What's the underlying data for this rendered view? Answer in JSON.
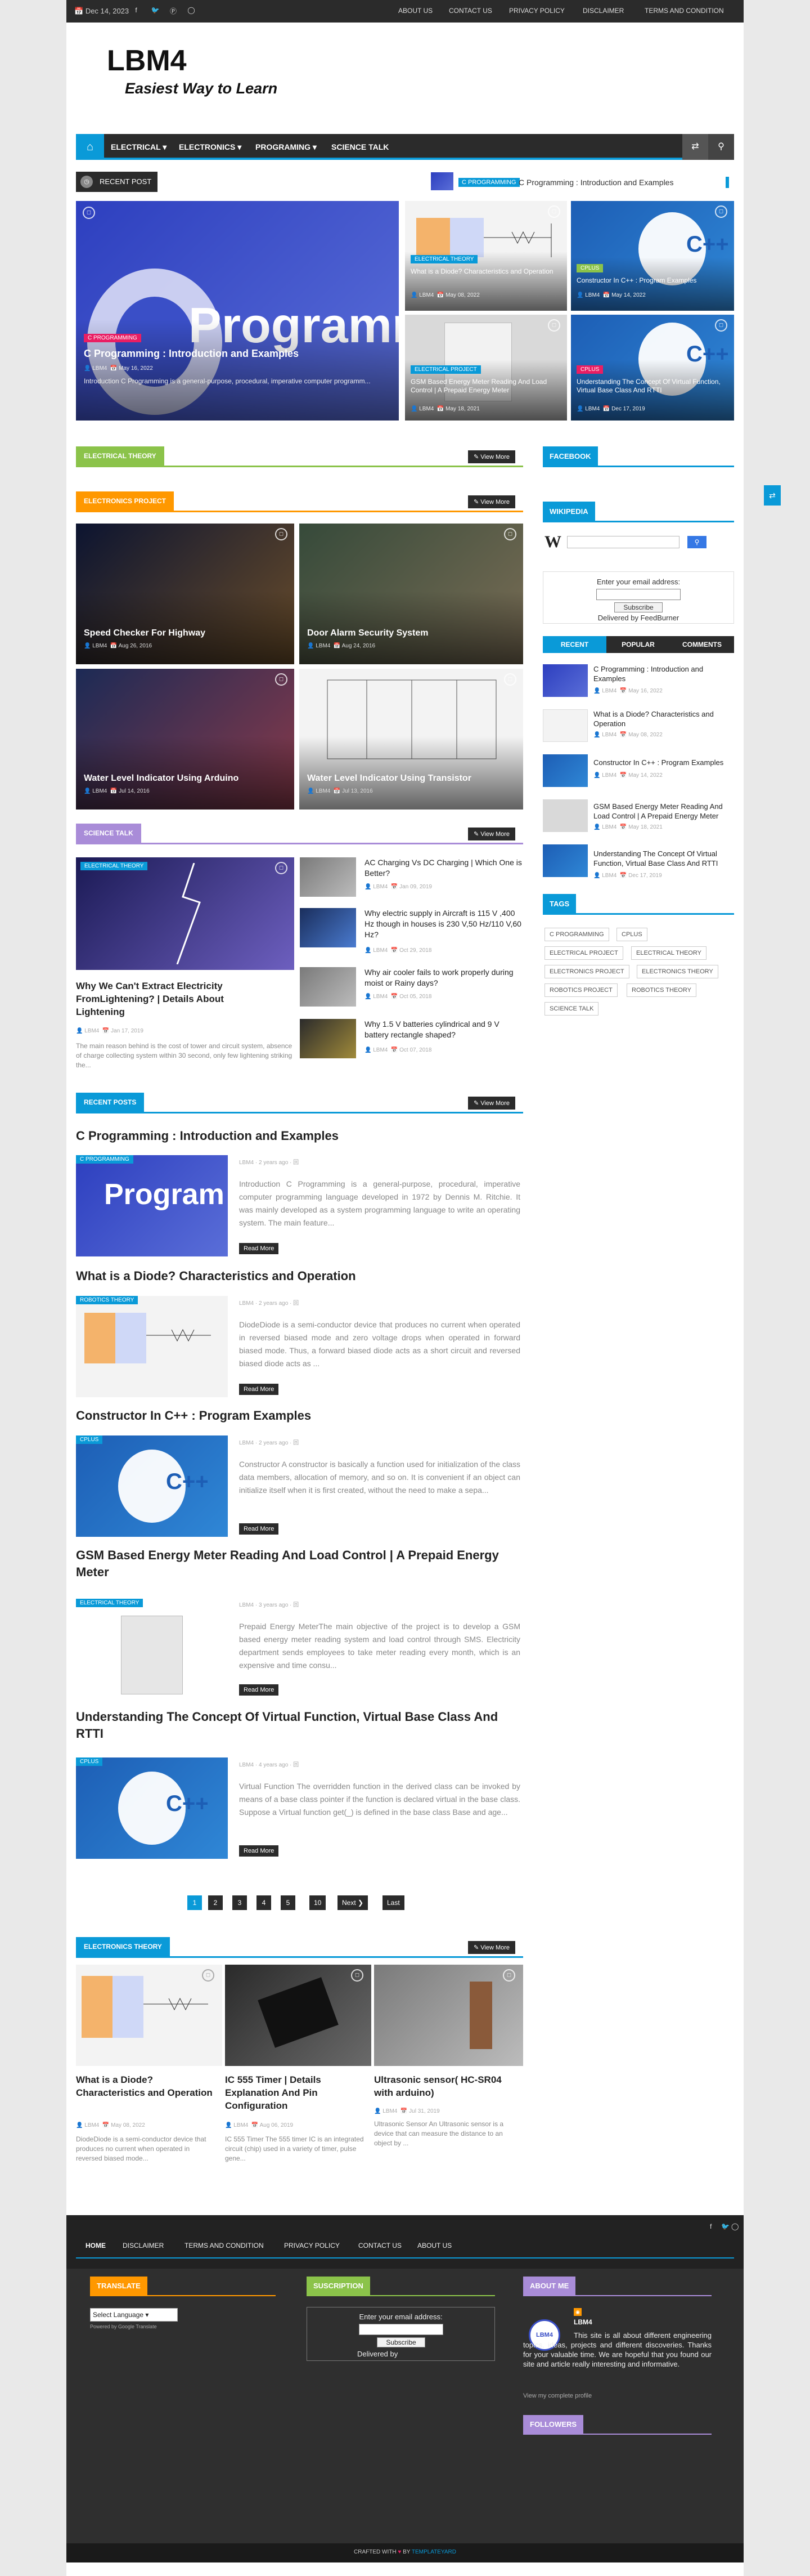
{
  "topbar": {
    "date": "Dec 14, 2023",
    "nav": [
      "ABOUT US",
      "CONTACT US",
      "PRIVACY POLICY",
      "DISCLAIMER",
      "TERMS AND CONDITION"
    ]
  },
  "logo": {
    "title": "LBM4",
    "tagline": "Easiest Way to Learn"
  },
  "mainnav": {
    "items": [
      "ELECTRICAL",
      "ELECTRONICS",
      "PROGRAMING",
      "SCIENCE TALK"
    ]
  },
  "ticker": {
    "label": "RECENT POST",
    "badge": "C PROGRAMMING",
    "text": "C Programming : Introduction and Examples"
  },
  "slider": {
    "main": {
      "badge": "C PROGRAMMING",
      "title": "C Programming : Introduction and Examples",
      "author": "LBM4",
      "date": "May 16, 2022",
      "excerpt": "Introduction C Programming is a general-purpose, procedural, imperative computer programm...",
      "art": "Programmi"
    },
    "small": [
      {
        "badge": "ELECTRICAL THEORY",
        "title": "What is a Diode? Characteristics and Operation",
        "author": "LBM4",
        "date": "May 08, 2022"
      },
      {
        "badge": "CPLUS",
        "title": "Constructor In C++ : Program Examples",
        "author": "LBM4",
        "date": "May 14, 2022"
      },
      {
        "badge": "ELECTRICAL PROJECT",
        "title": "GSM Based Energy Meter Reading And Load Control | A Prepaid Energy Meter",
        "author": "LBM4",
        "date": "May 18, 2021"
      },
      {
        "badge": "CPLUS",
        "title": "Understanding The Concept Of Virtual Function, Virtual Base Class And RTTI",
        "author": "LBM4",
        "date": "Dec 17, 2019"
      }
    ]
  },
  "sections": {
    "electrical_theory": "ELECTRICAL THEORY",
    "electronics_project": "ELECTRONICS PROJECT",
    "science_talk": "SCIENCE TALK",
    "recent_posts": "RECENT POSTS",
    "electronics_theory": "ELECTRONICS THEORY",
    "view_more": "View More"
  },
  "project_cards": [
    {
      "title": "Speed Checker For Highway",
      "author": "LBM4",
      "date": "Aug 26, 2016"
    },
    {
      "title": "Door Alarm Security System",
      "author": "LBM4",
      "date": "Aug 24, 2016"
    },
    {
      "title": "Water Level Indicator Using Arduino",
      "author": "LBM4",
      "date": "Jul 14, 2016"
    },
    {
      "title": "Water Level Indicator Using Transistor",
      "author": "LBM4",
      "date": "Jul 13, 2016"
    }
  ],
  "science": {
    "main": {
      "badge": "ELECTRICAL THEORY",
      "title": "Why We Can't Extract Electricity FromLightening? | Details About Lightening",
      "author": "LBM4",
      "date": "Jan 17, 2019",
      "excerpt": "The main reason behind is the cost of tower and circuit system, absence of charge collecting system within 30 second, only few lightening striking the..."
    },
    "list": [
      {
        "title": "AC Charging Vs DC Charging | Which One is Better?",
        "author": "LBM4",
        "date": "Jan 09, 2019"
      },
      {
        "title": "Why electric supply in Aircraft is 115 V ,400 Hz though in houses is 230 V,50 Hz/110 V,60 Hz?",
        "author": "LBM4",
        "date": "Oct 29, 2018"
      },
      {
        "title": "Why air cooler fails to work properly during moist or Rainy days?",
        "author": "LBM4",
        "date": "Oct 05, 2018"
      },
      {
        "title": "Why 1.5 V batteries cylindrical and 9 V battery rectangle shaped?",
        "author": "LBM4",
        "date": "Oct 07, 2018"
      }
    ]
  },
  "recent_posts": [
    {
      "title": "C Programming : Introduction and Examples",
      "badge": "C PROGRAMMING",
      "meta": "LBM4 · 2 years ago · 回",
      "excerpt": "Introduction C Programming is a general-purpose, procedural, imperative computer programming language developed in 1972 by Dennis M. Ritchie. It was mainly developed as a system programming language to write an operating system. The main feature...",
      "read": "Read More"
    },
    {
      "title": "What is a Diode? Characteristics and Operation",
      "badge": "ROBOTICS THEORY",
      "meta": "LBM4 · 2 years ago · 回",
      "excerpt": "DiodeDiode is a semi-conductor device that produces no current when operated in reversed biased mode and zero voltage drops when operated in forward biased mode. Thus, a forward biased diode acts as a short circuit and reversed biased diode acts as ...",
      "read": "Read More"
    },
    {
      "title": "Constructor In C++ : Program Examples",
      "badge": "CPLUS",
      "meta": "LBM4 · 2 years ago · 回",
      "excerpt": "Constructor  A constructor is basically a function used for initialization of the class data members, allocation of memory, and so on. It is convenient if an object can initialize itself when it is first created, without the need to make a sepa...",
      "read": "Read More"
    },
    {
      "title": "GSM Based Energy Meter Reading And Load Control | A Prepaid Energy Meter",
      "badge": "ELECTRICAL THEORY",
      "meta": "LBM4 · 3 years ago · 回",
      "excerpt": "Prepaid Energy MeterThe main objective of the project is to develop a GSM based energy meter reading system and load control through SMS. Electricity department sends employees to take meter reading every month, which is an expensive and time consu...",
      "read": "Read More"
    },
    {
      "title": "Understanding The Concept Of Virtual Function, Virtual Base Class And RTTI",
      "badge": "CPLUS",
      "meta": "LBM4 · 4 years ago · 回",
      "excerpt": "Virtual Function  The overridden function in the derived class can be invoked by means of a base class pointer if the function is declared virtual in the base class. Suppose a Virtual function get(_) is defined in the base class Base and age...",
      "read": "Read More"
    }
  ],
  "pagination": [
    "1",
    "2",
    "3",
    "4",
    "5",
    "10",
    "Next ❯",
    "Last"
  ],
  "electronics_theory_cards": [
    {
      "title": "What is a Diode? Characteristics and Operation",
      "author": "LBM4",
      "date": "May 08, 2022",
      "excerpt": "DiodeDiode is a semi-conductor device that produces no current when operated in reversed biased mode..."
    },
    {
      "title": "IC 555 Timer | Details Explanation And Pin Configuration",
      "author": "LBM4",
      "date": "Aug 06, 2019",
      "excerpt": "IC 555 Timer The 555 timer IC is an integrated circuit (chip) used in a variety of timer, pulse gene..."
    },
    {
      "title": "Ultrasonic sensor( HC-SR04 with arduino)",
      "author": "LBM4",
      "date": "Jul 31, 2019",
      "excerpt": "Ultrasonic Sensor An Ultrasonic sensor is a device that can measure the distance to an object by ..."
    }
  ],
  "sidebar": {
    "facebook": "FACEBOOK",
    "wikipedia": "WIKIPEDIA",
    "email_label": "Enter your email address:",
    "subscribe": "Subscribe",
    "delivered": "Delivered by FeedBurner",
    "tabs": [
      "RECENT",
      "POPULAR",
      "COMMENTS"
    ],
    "recent": [
      {
        "title": "C Programming : Introduction and Examples",
        "author": "LBM4",
        "date": "May 16, 2022"
      },
      {
        "title": "What is a Diode? Characteristics and Operation",
        "author": "LBM4",
        "date": "May 08, 2022"
      },
      {
        "title": "Constructor In C++ : Program Examples",
        "author": "LBM4",
        "date": "May 14, 2022"
      },
      {
        "title": "GSM Based Energy Meter Reading And Load Control | A Prepaid Energy Meter",
        "author": "LBM4",
        "date": "May 18, 2021"
      },
      {
        "title": "Understanding The Concept Of Virtual Function, Virtual Base Class And RTTI",
        "author": "LBM4",
        "date": "Dec 17, 2019"
      }
    ],
    "tags_label": "TAGS",
    "tags": [
      "C PROGRAMMING",
      "CPLUS",
      "ELECTRICAL PROJECT",
      "ELECTRICAL THEORY",
      "ELECTRONICS PROJECT",
      "ELECTRONICS THEORY",
      "ROBOTICS PROJECT",
      "ROBOTICS THEORY",
      "SCIENCE TALK"
    ]
  },
  "footer": {
    "nav": [
      "HOME",
      "DISCLAIMER",
      "TERMS AND CONDITION",
      "PRIVACY POLICY",
      "CONTACT US",
      "ABOUT US"
    ],
    "translate": "TRANSLATE",
    "select_language": "Select Language",
    "powered": "Powered by Google Translate",
    "subscription": "SUSCRIPTION",
    "email_label": "Enter your email address:",
    "subscribe": "Subscribe",
    "delivered": "Delivered by",
    "about": "ABOUT ME",
    "about_name": "LBM4",
    "about_text": "This site is all about different engineering topics, ideas, projects and different discoveries. Thanks for your valuable time. We are hopeful that you found our site and article really interesting and informative.",
    "view_profile": "View my complete profile",
    "followers": "FOLLOWERS",
    "credit_prefix": "CRAFTED WITH",
    "credit_by": "BY",
    "credit_link": "TEMPLATEYARD"
  },
  "colors": {
    "accent": "#0a9ad8",
    "green": "#8bc34a",
    "orange": "#ff9800",
    "purple": "#a98cd8",
    "dark": "#2b2b2b",
    "pink": "#e91e63"
  }
}
